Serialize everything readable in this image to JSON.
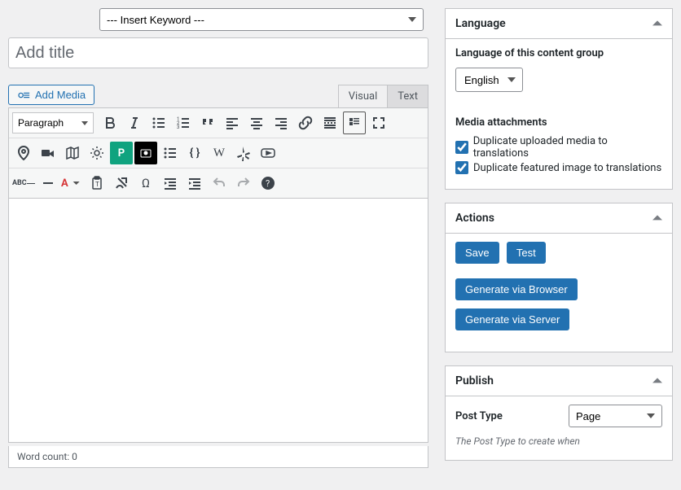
{
  "keyword_select": {
    "selected": "--- Insert Keyword ---"
  },
  "title": {
    "placeholder": "Add title",
    "value": ""
  },
  "editor": {
    "add_media": "Add Media",
    "tabs": {
      "visual": "Visual",
      "text": "Text"
    },
    "format_select": "Paragraph",
    "content": "",
    "word_count_label": "Word count: 0",
    "icons": {
      "bold": "bold-icon",
      "italic": "italic-icon",
      "ul": "list-ul-icon",
      "ol": "list-ol-icon",
      "quote": "quote-icon",
      "align_left": "align-left-icon",
      "align_center": "align-center-icon",
      "align_right": "align-right-icon",
      "link": "link-icon",
      "more": "read-more-icon",
      "toolbar_toggle": "toolbar-toggle-icon",
      "fullscreen": "fullscreen-icon",
      "location": "location-icon",
      "video": "video-camera-icon",
      "map": "map-icon",
      "brightness": "brightness-icon",
      "p_block": "parking-icon",
      "camera_box": "camera-box-icon",
      "list2": "list-icon",
      "braces": "braces-icon",
      "wikipedia": "wikipedia-icon",
      "yelp": "yelp-icon",
      "youtube": "youtube-icon",
      "abc": "spellcheck-icon",
      "hr": "horizontal-rule-icon",
      "text_color": "text-color-icon",
      "paste": "paste-icon",
      "clear": "clear-format-icon",
      "char": "special-char-icon",
      "outdent": "outdent-icon",
      "indent": "indent-icon",
      "undo": "undo-icon",
      "redo": "redo-icon",
      "help": "help-icon"
    }
  },
  "language_panel": {
    "title": "Language",
    "content_group_label": "Language of this content group",
    "selected_language": "English",
    "media_heading": "Media attachments",
    "checkbox1": "Duplicate uploaded media to translations",
    "checkbox2": "Duplicate featured image to translations"
  },
  "actions_panel": {
    "title": "Actions",
    "save": "Save",
    "test": "Test",
    "gen_browser": "Generate via Browser",
    "gen_server": "Generate via Server"
  },
  "publish_panel": {
    "title": "Publish",
    "post_type_label": "Post Type",
    "post_type_value": "Page",
    "help": "The Post Type to create when"
  }
}
